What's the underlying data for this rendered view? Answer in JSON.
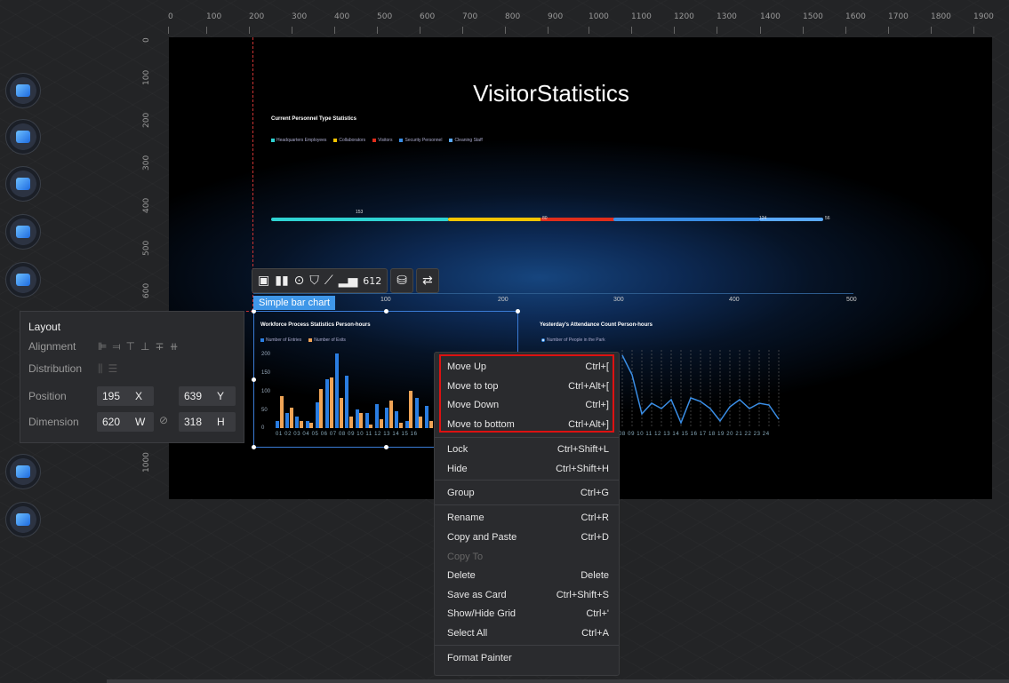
{
  "ruler_top": [
    "0",
    "100",
    "200",
    "300",
    "400",
    "500",
    "600",
    "700",
    "800",
    "900",
    "1000",
    "1100",
    "1200",
    "1300",
    "1400",
    "1500",
    "1600",
    "1700",
    "1800",
    "1900"
  ],
  "ruler_left": [
    "0",
    "100",
    "200",
    "300",
    "400",
    "500",
    "600",
    "1000"
  ],
  "canvas": {
    "title": "VisitorStatistics",
    "personnel": {
      "title": "Current Personnel Type Statistics",
      "legend": [
        "Headquarters Employees",
        "Collaborators",
        "Visitors",
        "Security Personnel",
        "Cleaning Staff"
      ],
      "colors": [
        "#2fd3d3",
        "#f5c400",
        "#e02d1b",
        "#3a8ee6",
        "#5aa9ff"
      ],
      "values": [
        "153",
        "80",
        "",
        "124",
        "56"
      ],
      "axis": [
        "100",
        "200",
        "300",
        "400",
        "500"
      ]
    },
    "workforce": {
      "title": "Workforce Process Statistics Person-hours",
      "legend": [
        "Number of Entries",
        "Number of Exits"
      ],
      "y_ticks": [
        "200",
        "150",
        "100",
        "50",
        "0"
      ],
      "x_labels": "01 02 03 04 05 06 07 08 09 10 11 12 13 14 15 16",
      "entries": [
        20,
        40,
        30,
        20,
        70,
        130,
        200,
        140,
        50,
        40,
        65,
        55,
        45,
        20,
        80,
        60
      ],
      "exits": [
        85,
        55,
        20,
        15,
        105,
        135,
        80,
        30,
        40,
        10,
        25,
        75,
        15,
        100,
        30,
        20
      ]
    },
    "attendance": {
      "title": "Yesterday's Attendance Count Person-hours",
      "legend": "Number of People in the Park",
      "x_labels": "08 09 10 11 12 13 14 15 16 17 18 19 20 21 22 23 24"
    }
  },
  "selection": {
    "label": "Simple bar chart"
  },
  "toolbar": {
    "icons": [
      "image-icon",
      "bar-chart-icon",
      "map-icon",
      "marquee-icon",
      "curve-icon",
      "sort-chart-icon",
      "number-icon",
      "database-icon",
      "swap-icon"
    ]
  },
  "layout_panel": {
    "title": "Layout",
    "alignment_label": "Alignment",
    "distribution_label": "Distribution",
    "position_label": "Position",
    "dimension_label": "Dimension",
    "x": "195",
    "x_unit": "X",
    "y": "639",
    "y_unit": "Y",
    "w": "620",
    "w_unit": "W",
    "h": "318",
    "h_unit": "H"
  },
  "context_menu": {
    "items": [
      {
        "label": "Move Up",
        "shortcut": "Ctrl+["
      },
      {
        "label": "Move to top",
        "shortcut": "Ctrl+Alt+["
      },
      {
        "label": "Move Down",
        "shortcut": "Ctrl+]"
      },
      {
        "label": "Move to bottom",
        "shortcut": "Ctrl+Alt+]"
      },
      {
        "label": "Lock",
        "shortcut": "Ctrl+Shift+L"
      },
      {
        "label": "Hide",
        "shortcut": "Ctrl+Shift+H"
      },
      {
        "label": "Group",
        "shortcut": "Ctrl+G"
      },
      {
        "label": "Rename",
        "shortcut": "Ctrl+R"
      },
      {
        "label": "Copy and Paste",
        "shortcut": "Ctrl+D"
      },
      {
        "label": "Copy To",
        "shortcut": ""
      },
      {
        "label": "Delete",
        "shortcut": "Delete"
      },
      {
        "label": "Save as Card",
        "shortcut": "Ctrl+Shift+S"
      },
      {
        "label": "Show/Hide Grid",
        "shortcut": "Ctrl+'"
      },
      {
        "label": "Select All",
        "shortcut": "Ctrl+A"
      },
      {
        "label": "Format Painter",
        "shortcut": ""
      }
    ]
  }
}
